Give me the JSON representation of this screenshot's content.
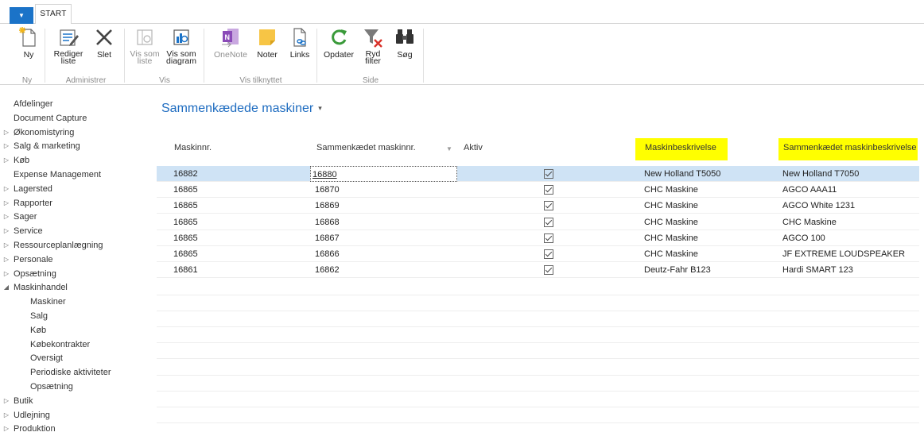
{
  "tabs": {
    "start": "START"
  },
  "ribbon": {
    "new_label": "Ny",
    "edit_list_label": "Rediger liste",
    "delete_label": "Slet",
    "view_list_label": "Vis som liste",
    "view_chart_label": "Vis som diagram",
    "onenote_label": "OneNote",
    "notes_label": "Noter",
    "links_label": "Links",
    "refresh_label": "Opdater",
    "clear_filter_label": "Ryd filter",
    "search_label": "Søg",
    "groups": {
      "new": "Ny",
      "manage": "Administrer",
      "view": "Vis",
      "show_attached": "Vis tilknyttet",
      "page": "Side"
    }
  },
  "nav": [
    {
      "label": "Afdelinger",
      "indent": 0,
      "expander": ""
    },
    {
      "label": "Document Capture",
      "indent": 0,
      "expander": ""
    },
    {
      "label": "Økonomistyring",
      "indent": 0,
      "expander": "▷"
    },
    {
      "label": "Salg & marketing",
      "indent": 0,
      "expander": "▷"
    },
    {
      "label": "Køb",
      "indent": 0,
      "expander": "▷"
    },
    {
      "label": "Expense Management",
      "indent": 0,
      "expander": ""
    },
    {
      "label": "Lagersted",
      "indent": 0,
      "expander": "▷"
    },
    {
      "label": "Rapporter",
      "indent": 0,
      "expander": "▷"
    },
    {
      "label": "Sager",
      "indent": 0,
      "expander": "▷"
    },
    {
      "label": "Service",
      "indent": 0,
      "expander": "▷"
    },
    {
      "label": "Ressourceplanlægning",
      "indent": 0,
      "expander": "▷"
    },
    {
      "label": "Personale",
      "indent": 0,
      "expander": "▷"
    },
    {
      "label": "Opsætning",
      "indent": 0,
      "expander": "▷"
    },
    {
      "label": "Maskinhandel",
      "indent": 0,
      "expander": "◢"
    },
    {
      "label": "Maskiner",
      "indent": 1,
      "expander": ""
    },
    {
      "label": "Salg",
      "indent": 1,
      "expander": ""
    },
    {
      "label": "Køb",
      "indent": 1,
      "expander": ""
    },
    {
      "label": "Købekontrakter",
      "indent": 1,
      "expander": ""
    },
    {
      "label": "Oversigt",
      "indent": 1,
      "expander": ""
    },
    {
      "label": "Periodiske aktiviteter",
      "indent": 1,
      "expander": ""
    },
    {
      "label": "Opsætning",
      "indent": 1,
      "expander": ""
    },
    {
      "label": "Butik",
      "indent": 0,
      "expander": "▷"
    },
    {
      "label": "Udlejning",
      "indent": 0,
      "expander": "▷"
    },
    {
      "label": "Produktion",
      "indent": 0,
      "expander": "▷"
    }
  ],
  "page": {
    "title": "Sammenkædede maskiner",
    "title_caret": "▾"
  },
  "columns": {
    "machine_no": "Maskinnr.",
    "linked_machine_no": "Sammenkædet maskinnr.",
    "active": "Aktiv",
    "machine_desc": "Maskinbeskrivelse",
    "linked_machine_desc": "Sammenkædet maskinbeskrivelse"
  },
  "rows": [
    {
      "machine_no": "16882",
      "linked_machine_no": "16880",
      "active": true,
      "machine_desc": "New Holland T5050",
      "linked_machine_desc": "New Holland T7050"
    },
    {
      "machine_no": "16865",
      "linked_machine_no": "16870",
      "active": true,
      "machine_desc": "CHC Maskine",
      "linked_machine_desc": "AGCO AAA11"
    },
    {
      "machine_no": "16865",
      "linked_machine_no": "16869",
      "active": true,
      "machine_desc": "CHC Maskine",
      "linked_machine_desc": "AGCO White 1231"
    },
    {
      "machine_no": "16865",
      "linked_machine_no": "16868",
      "active": true,
      "machine_desc": "CHC Maskine",
      "linked_machine_desc": "CHC Maskine"
    },
    {
      "machine_no": "16865",
      "linked_machine_no": "16867",
      "active": true,
      "machine_desc": "CHC Maskine",
      "linked_machine_desc": "AGCO 100"
    },
    {
      "machine_no": "16865",
      "linked_machine_no": "16866",
      "active": true,
      "machine_desc": "CHC Maskine",
      "linked_machine_desc": "JF EXTREME LOUDSPEAKER"
    },
    {
      "machine_no": "16861",
      "linked_machine_no": "16862",
      "active": true,
      "machine_desc": "Deutz-Fahr B123",
      "linked_machine_desc": "Hardi SMART 123"
    }
  ],
  "colors": {
    "accent": "#1e6cc0",
    "file_button": "#1b73c8",
    "selected_row": "#cfe3f5",
    "highlight": "#ffff00"
  }
}
